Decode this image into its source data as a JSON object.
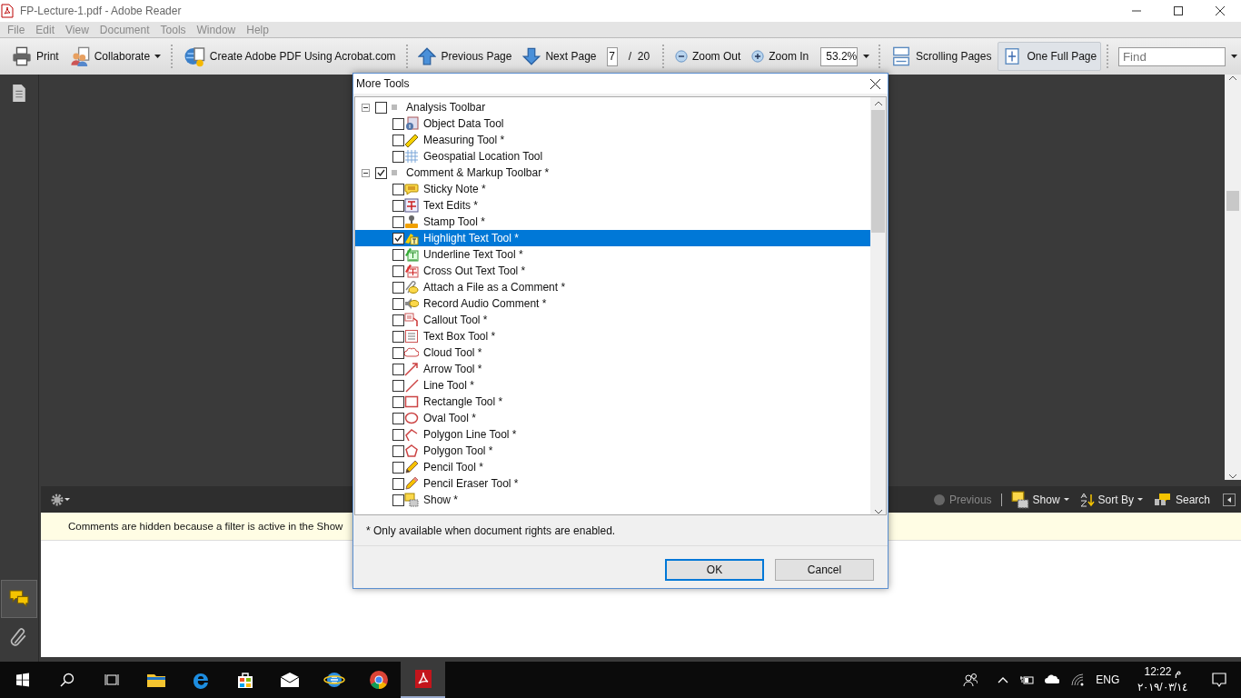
{
  "window": {
    "title": "FP-Lecture-1.pdf - Adobe Reader"
  },
  "menu": [
    "File",
    "Edit",
    "View",
    "Document",
    "Tools",
    "Window",
    "Help"
  ],
  "toolbar": {
    "print": "Print",
    "collaborate": "Collaborate",
    "create_pdf": "Create Adobe PDF Using Acrobat.com",
    "previous_page": "Previous Page",
    "next_page": "Next Page",
    "page_number": "7",
    "page_count": "/  20",
    "zoom_out": "Zoom Out",
    "zoom_in": "Zoom In",
    "zoom_value": "53.2%",
    "scrolling_pages": {
      "label": "Scrolling Pages",
      "selected": false
    },
    "one_full_page": {
      "label": "One Full Page",
      "selected": true
    },
    "find_placeholder": "Find"
  },
  "nav_buttons": [
    {
      "selected": false
    },
    {
      "selected": true
    },
    {
      "selected": false
    }
  ],
  "comments_panel": {
    "previous": {
      "label": "Previous",
      "disabled": true
    },
    "show": "Show",
    "sort_by": "Sort By",
    "search": "Search",
    "message": "Comments are hidden because a filter is active in the Show"
  },
  "dialog": {
    "title": "More Tools",
    "groups": [
      {
        "label": "Analysis Toolbar",
        "checked": false,
        "expanded": true,
        "children": [
          {
            "label": "Object Data Tool",
            "checked": false,
            "selected": false
          },
          {
            "label": "Measuring Tool *",
            "checked": false,
            "selected": false
          },
          {
            "label": "Geospatial Location Tool",
            "checked": false,
            "selected": false
          }
        ]
      },
      {
        "label": "Comment & Markup Toolbar *",
        "checked": true,
        "expanded": true,
        "children": [
          {
            "label": "Sticky Note *",
            "checked": false,
            "selected": false
          },
          {
            "label": "Text Edits *",
            "checked": false,
            "selected": false
          },
          {
            "label": "Stamp Tool *",
            "checked": false,
            "selected": false
          },
          {
            "label": "Highlight Text Tool *",
            "checked": true,
            "selected": true
          },
          {
            "label": "Underline Text Tool *",
            "checked": false,
            "selected": false
          },
          {
            "label": "Cross Out Text Tool *",
            "checked": false,
            "selected": false
          },
          {
            "label": "Attach a File as a Comment *",
            "checked": false,
            "selected": false
          },
          {
            "label": "Record Audio Comment *",
            "checked": false,
            "selected": false
          },
          {
            "label": "Callout Tool *",
            "checked": false,
            "selected": false
          },
          {
            "label": "Text Box Tool *",
            "checked": false,
            "selected": false
          },
          {
            "label": "Cloud Tool *",
            "checked": false,
            "selected": false
          },
          {
            "label": "Arrow Tool *",
            "checked": false,
            "selected": false
          },
          {
            "label": "Line Tool *",
            "checked": false,
            "selected": false
          },
          {
            "label": "Rectangle Tool *",
            "checked": false,
            "selected": false
          },
          {
            "label": "Oval Tool *",
            "checked": false,
            "selected": false
          },
          {
            "label": "Polygon Line Tool *",
            "checked": false,
            "selected": false
          },
          {
            "label": "Polygon Tool *",
            "checked": false,
            "selected": false
          },
          {
            "label": "Pencil Tool *",
            "checked": false,
            "selected": false
          },
          {
            "label": "Pencil Eraser Tool *",
            "checked": false,
            "selected": false
          },
          {
            "label": "Show *",
            "checked": false,
            "selected": false
          }
        ]
      }
    ],
    "note": "* Only available when document rights are enabled.",
    "buttons": [
      {
        "label": "OK",
        "default": true
      },
      {
        "label": "Cancel",
        "default": false
      }
    ]
  },
  "taskbar": {
    "apps": [
      {
        "selected": false
      },
      {
        "selected": false
      },
      {
        "selected": false
      },
      {
        "selected": false
      },
      {
        "selected": false
      },
      {
        "selected": false
      },
      {
        "selected": true
      }
    ]
  },
  "tray": {
    "language": "ENG",
    "time": "12:22 م",
    "date": "٢٠١٩/٠٣/١٤"
  }
}
